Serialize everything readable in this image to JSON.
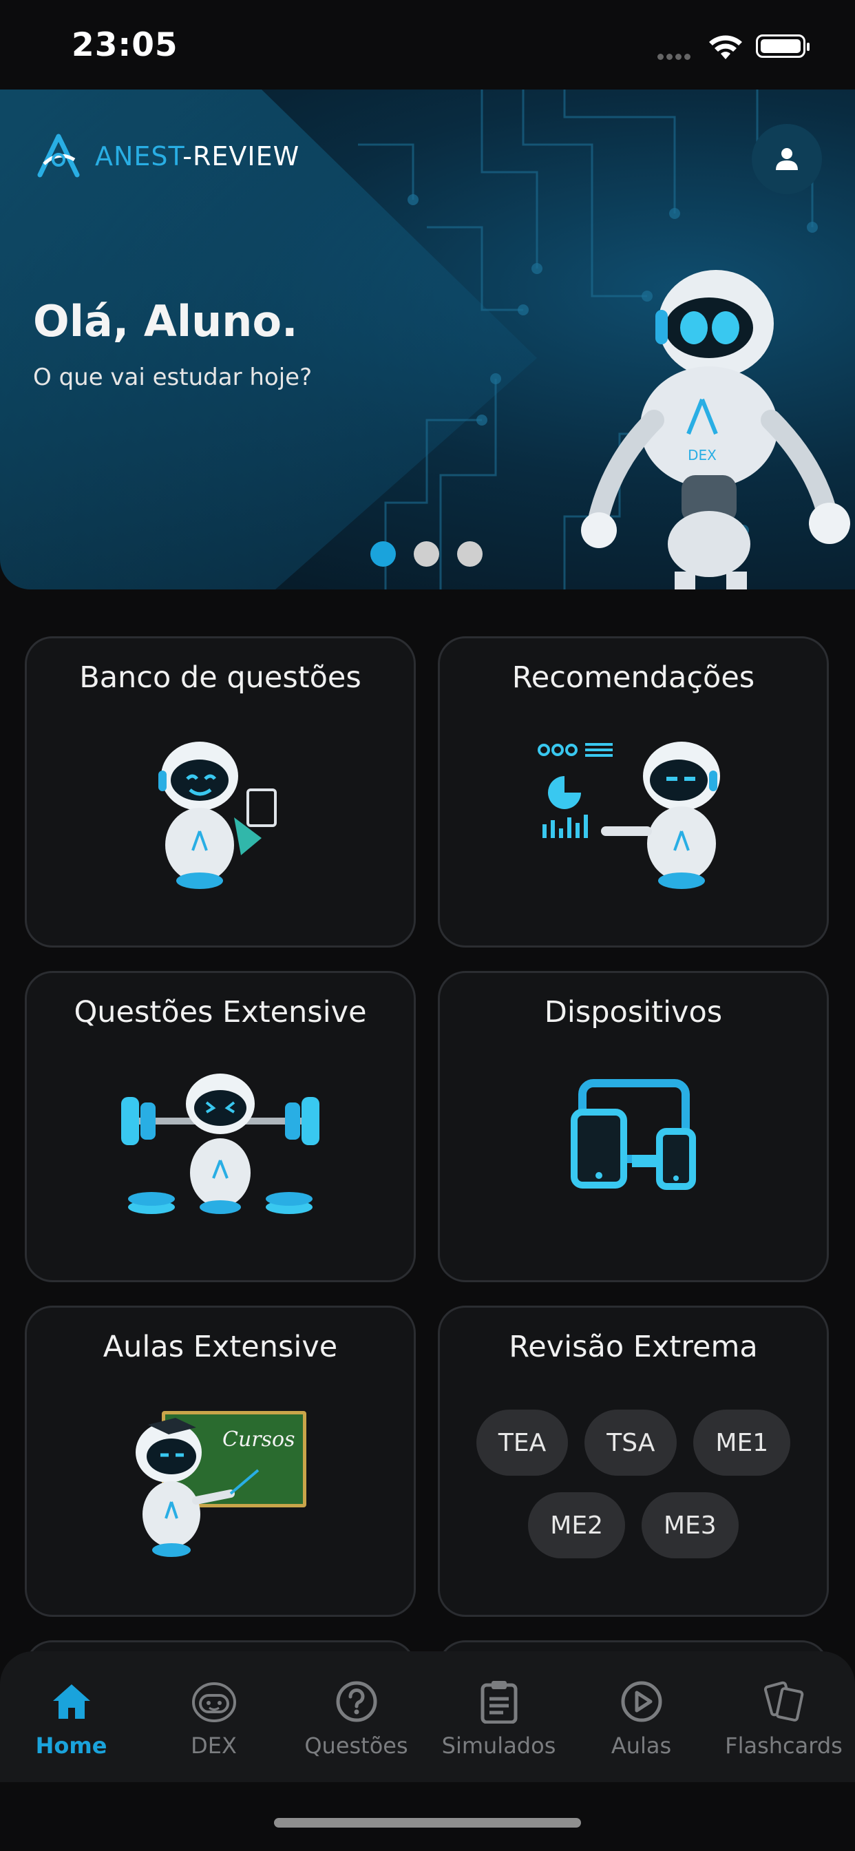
{
  "status_bar": {
    "time": "23:05"
  },
  "header": {
    "logo_prefix": "ANEST",
    "logo_suffix": "-REVIEW"
  },
  "hero": {
    "greeting": "Olá, Aluno.",
    "subtitle": "O que vai estudar hoje?",
    "carousel": {
      "pages": 3,
      "active_index": 0
    },
    "robot_badge": "DEX"
  },
  "cards": [
    {
      "title": "Banco de questões",
      "icon": "robot-clipboard-icon"
    },
    {
      "title": "Recomendações",
      "icon": "robot-analytics-icon"
    },
    {
      "title": "Questões Extensive",
      "icon": "robot-weightlifting-icon"
    },
    {
      "title": "Dispositivos",
      "icon": "devices-icon"
    },
    {
      "title": "Aulas Extensive",
      "icon": "robot-chalkboard-icon",
      "board_text": "Cursos"
    },
    {
      "title": "Revisão Extrema",
      "chips": [
        "TEA",
        "TSA",
        "ME1",
        "ME2",
        "ME3"
      ]
    }
  ],
  "bottom_nav": {
    "active": "Home",
    "items": [
      {
        "label": "Home",
        "icon": "home-icon"
      },
      {
        "label": "DEX",
        "icon": "robot-face-icon"
      },
      {
        "label": "Questões",
        "icon": "question-circle-icon"
      },
      {
        "label": "Simulados",
        "icon": "clipboard-icon"
      },
      {
        "label": "Aulas",
        "icon": "play-circle-icon"
      },
      {
        "label": "Flashcards",
        "icon": "cards-icon"
      }
    ]
  },
  "colors": {
    "accent": "#1aa3dc",
    "background": "#0c0c0d",
    "card": "#131416"
  }
}
